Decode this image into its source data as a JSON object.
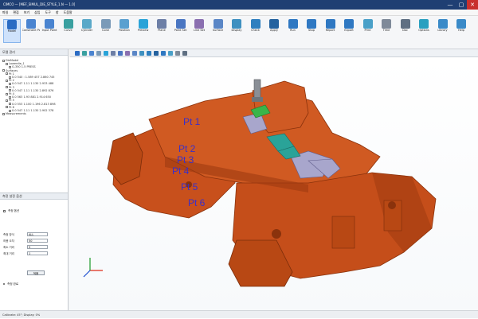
{
  "window": {
    "title": "CIMCO — [MEF_SIMUL_DIE_STYLE_1.N — 1.0]",
    "controls": [
      "—",
      "▢",
      "✕"
    ]
  },
  "menu": [
    "파일",
    "편집",
    "보기",
    "삽입",
    "도구",
    "창",
    "도움말"
  ],
  "ribbon": {
    "groups": [
      {
        "label": "Model",
        "color": "#2b6cc4"
      },
      {
        "label": "Constraint Point",
        "color": "#4a84d0"
      },
      {
        "label": "Input Point",
        "color": "#4a84d0"
      },
      {
        "label": "Curve",
        "color": "#3aa0a0"
      },
      {
        "label": "Cylinder",
        "color": "#5aa8c8"
      },
      {
        "label": "Cone",
        "color": "#7a9ab8"
      },
      {
        "label": "Position",
        "color": "#5aa0d0"
      },
      {
        "label": "Preview",
        "color": "#2aa3d8"
      },
      {
        "label": "Plane",
        "color": "#6d7fa6"
      },
      {
        "label": "Point Set",
        "color": "#4a76c2"
      },
      {
        "label": "Line Set",
        "color": "#8a6fb0"
      },
      {
        "label": "Surface",
        "color": "#5a86c6"
      },
      {
        "label": "Display",
        "color": "#3e90c0"
      },
      {
        "label": "Check",
        "color": "#2f7fbf"
      },
      {
        "label": "Apply",
        "color": "#24629f"
      },
      {
        "label": "Run",
        "color": "#2f78c2"
      },
      {
        "label": "Stop",
        "color": "#2f78c2"
      },
      {
        "label": "Report",
        "color": "#2f78c2"
      },
      {
        "label": "Export",
        "color": "#2f78c2"
      },
      {
        "label": "Print",
        "color": "#4aa0c8"
      },
      {
        "label": "Time",
        "color": "#7f8a99"
      },
      {
        "label": "Doc",
        "color": "#5f6f82"
      },
      {
        "label": "Options",
        "color": "#2aa0c0"
      },
      {
        "label": "Library",
        "color": "#3a8ac8"
      },
      {
        "label": "Help",
        "color": "#3a8ac8"
      }
    ]
  },
  "tree": {
    "header": "모델 관리",
    "items": [
      {
        "indent": 0,
        "text": "DieModel"
      },
      {
        "indent": 1,
        "text": "Lowerdie_1"
      },
      {
        "indent": 2,
        "text": "G-350 1.5 PRESS"
      },
      {
        "indent": 0,
        "text": "Surfaces"
      },
      {
        "indent": 1,
        "text": "Pt 1"
      },
      {
        "indent": 2,
        "text": "0.0 540 : 1.589 457 2.860 745"
      },
      {
        "indent": 1,
        "text": "Pt 2"
      },
      {
        "indent": 2,
        "text": "0.0 547 1.11 1.130 2.933 488"
      },
      {
        "indent": 1,
        "text": "Pt 3"
      },
      {
        "indent": 2,
        "text": "0.0 547 1.11 1.130 2.892 876"
      },
      {
        "indent": 1,
        "text": "Pt 4"
      },
      {
        "indent": 2,
        "text": "0.0 563 1.93 881 2.914 650"
      },
      {
        "indent": 1,
        "text": "Pt 5"
      },
      {
        "indent": 2,
        "text": "0.0 553 1.100 1.196 2.813 898"
      },
      {
        "indent": 1,
        "text": "Pt 6"
      },
      {
        "indent": 2,
        "text": "0.0 547 1.11 1.130 2.902 378"
      },
      {
        "indent": 0,
        "text": "Measurements"
      }
    ]
  },
  "props": {
    "header": "측정 설정 옵션",
    "checkbox": "측정 옵션",
    "fields": [
      {
        "label": "측정 방식",
        "value": "ALL"
      },
      {
        "label": "허용 오차",
        "value": "50"
      },
      {
        "label": "최소 거리",
        "value": "5"
      },
      {
        "label": "최대 거리",
        "value": "1"
      }
    ],
    "apply": "적용",
    "footnote": "측정 완료"
  },
  "points": [
    "Pt 1",
    "Pt 2",
    "Pt 3",
    "Pt 4",
    "Pt 5",
    "Pt 6"
  ],
  "status": "Calibrate: 45°; Display: 0%",
  "colors": {
    "titlebar": "#1f3f73",
    "die": "#c8501c",
    "die_shadow": "#9e3b10",
    "die_light": "#d9642a",
    "measure_block": "#a8a6cc",
    "green_part": "#39b54a",
    "teal_part": "#2aa398",
    "probe": "#8a8f96",
    "label": "#3a2fc8"
  }
}
